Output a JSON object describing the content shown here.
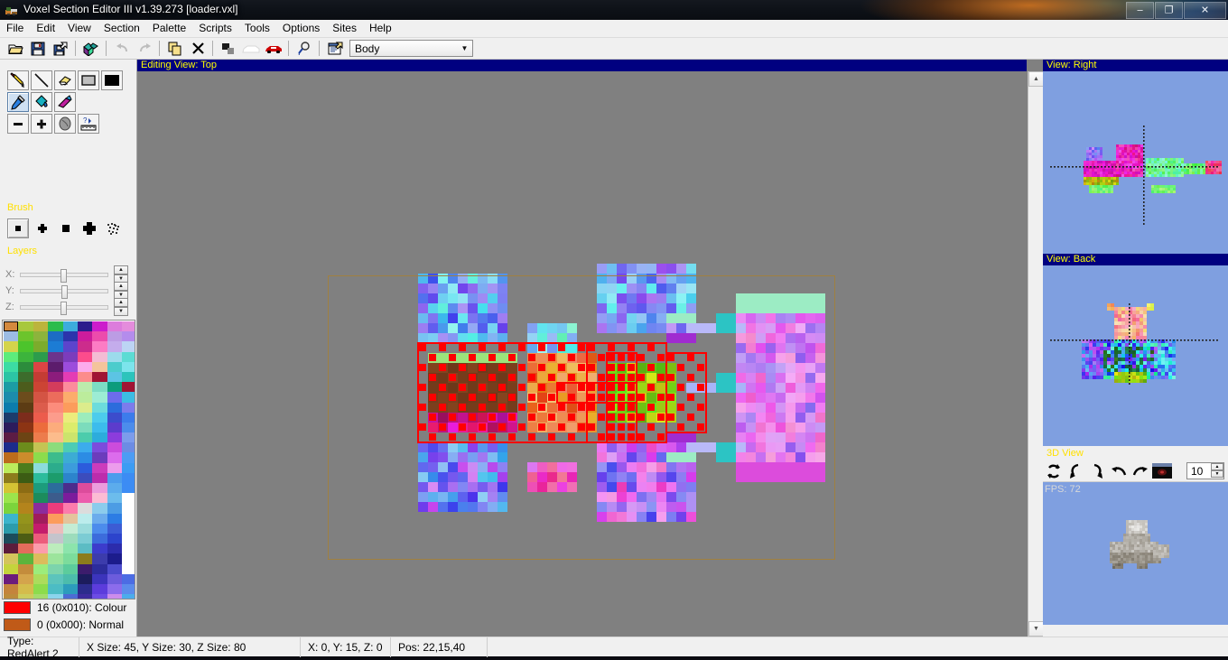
{
  "window": {
    "title": "Voxel Section Editor III v1.39.273 [loader.vxl]",
    "app_icon": "voxel-app-icon",
    "minimize_label": "–",
    "maximize_label": "❐",
    "close_label": "✕"
  },
  "menu": {
    "items": [
      {
        "label": "File"
      },
      {
        "label": "Edit"
      },
      {
        "label": "View"
      },
      {
        "label": "Section"
      },
      {
        "label": "Palette"
      },
      {
        "label": "Scripts"
      },
      {
        "label": "Tools"
      },
      {
        "label": "Options"
      },
      {
        "label": "Sites"
      },
      {
        "label": "Help"
      }
    ]
  },
  "toolbar": {
    "buttons": [
      {
        "name": "open-file-button",
        "icon": "folder-open-icon"
      },
      {
        "name": "save-file-button",
        "icon": "floppy-save-icon"
      },
      {
        "name": "save-as-button",
        "icon": "save-as-icon"
      },
      {
        "name": "new-section-button",
        "icon": "voxel-cube-icon"
      },
      {
        "name": "undo-button",
        "icon": "undo-arrow-icon"
      },
      {
        "name": "redo-button",
        "icon": "redo-arrow-icon"
      },
      {
        "name": "copy-button",
        "icon": "copy-pages-icon"
      },
      {
        "name": "delete-button",
        "icon": "x-delete-icon"
      },
      {
        "name": "normals-button",
        "icon": "two-squares-icon"
      },
      {
        "name": "white-vehicle-button",
        "icon": "white-car-icon"
      },
      {
        "name": "red-vehicle-button",
        "icon": "red-car-icon"
      },
      {
        "name": "zoom-button",
        "icon": "magnifier-icon"
      },
      {
        "name": "properties-button",
        "icon": "properties-window-icon"
      }
    ],
    "section_combo": {
      "value": "Body",
      "arrow_icon": "chevron-down-icon"
    }
  },
  "tools_panel": {
    "rows": [
      [
        {
          "name": "pencil-tool",
          "icon": "pencil-icon",
          "selected": false
        },
        {
          "name": "line-tool",
          "icon": "line-icon",
          "selected": false
        },
        {
          "name": "eraser-tool",
          "icon": "eraser-icon",
          "selected": false
        },
        {
          "name": "rectangle-tool",
          "icon": "rectangle-outline-icon",
          "selected": false
        },
        {
          "name": "filled-rectangle-tool",
          "icon": "rectangle-filled-icon",
          "selected": false
        }
      ],
      [
        {
          "name": "color-picker-tool",
          "icon": "eyedropper-icon",
          "selected": true
        },
        {
          "name": "fill-tool",
          "icon": "paint-bucket-icon",
          "selected": false
        },
        {
          "name": "smudge-tool",
          "icon": "smudge-icon",
          "selected": false
        }
      ],
      [
        {
          "name": "minus-tool",
          "icon": "minus-icon",
          "selected": false
        },
        {
          "name": "plus-tool",
          "icon": "plus-icon",
          "selected": false
        },
        {
          "name": "blob-tool",
          "icon": "blob-icon",
          "selected": false
        },
        {
          "name": "measure-tool",
          "icon": "ruler-question-icon",
          "selected": false
        }
      ]
    ],
    "brush": {
      "label": "Brush",
      "options": [
        {
          "name": "brush-dot",
          "icon": "small-square-icon",
          "selected": true
        },
        {
          "name": "brush-plus",
          "icon": "plus-brush-icon",
          "selected": false
        },
        {
          "name": "brush-square",
          "icon": "square-brush-icon",
          "selected": false
        },
        {
          "name": "brush-cross",
          "icon": "cross-brush-icon",
          "selected": false
        },
        {
          "name": "brush-noise",
          "icon": "noise-brush-icon",
          "selected": false
        }
      ]
    },
    "layers": {
      "label": "Layers",
      "sliders": [
        {
          "name": "layer-x-slider",
          "label": "X:",
          "pos_pct": 48
        },
        {
          "name": "layer-y-slider",
          "label": "Y:",
          "pos_pct": 49
        },
        {
          "name": "layer-z-slider",
          "label": "Z:",
          "pos_pct": 48
        }
      ]
    }
  },
  "palette": {
    "selected_index": 0,
    "info": [
      {
        "name": "primary-color",
        "swatch": "#ff0000",
        "text": "16 (0x010): Colour"
      },
      {
        "name": "secondary-color",
        "swatch": "#c05a18",
        "text": "0 (0x000): Normal"
      }
    ],
    "colors": [
      "#d4893e",
      "#a8c83c",
      "#bcb43c",
      "#2cbc4c",
      "#3cacdc",
      "#2c1c8c",
      "#cc1ccc",
      "#dc7cdc",
      "#9cbce4",
      "#6cc42c",
      "#8cb43c",
      "#1c6cc4",
      "#2c34ac",
      "#cc1c9c",
      "#ec4cac",
      "#bc9ce4",
      "#d4d44c",
      "#4cc42c",
      "#7cac2c",
      "#1c7cd4",
      "#5c44cc",
      "#cc2c8c",
      "#fc7cc4",
      "#c4acec",
      "#5cec7c",
      "#3cb43c",
      "#2c9c4c",
      "#6c348c",
      "#7c3cbc",
      "#fc4c8c",
      "#f4bcd4",
      "#9cdcec",
      "#3cdca4",
      "#2c8c3c",
      "#dc4444",
      "#5c1c6c",
      "#9c4cdc",
      "#fcacec",
      "#f4c49c",
      "#4ccccc",
      "#2cc4a4",
      "#3c6c2c",
      "#c43c34",
      "#8c1c7c",
      "#e43cb4",
      "#fc8c8c",
      "#a01434",
      "#5cc4e4",
      "#1c9ca4",
      "#4c5c1c",
      "#cc4434",
      "#d43c5c",
      "#fc8c9c",
      "#bcecac",
      "#7cdcc4",
      "#0c9c7c",
      "#1c8cac",
      "#6c4c1c",
      "#d45444",
      "#ec6c5c",
      "#fcac6c",
      "#bcec9c",
      "#9cecd4",
      "#6c6cec",
      "#0c7cac",
      "#5c3c14",
      "#dc5c4c",
      "#fc8c7c",
      "#fc9c5c",
      "#dcec8c",
      "#6cdcdc",
      "#2c6cdc",
      "#1c3c6c",
      "#7c2c1c",
      "#ec5c4c",
      "#fc9c8c",
      "#ecec7c",
      "#9cecbc",
      "#4cccec",
      "#3c4ccc",
      "#2c1c5c",
      "#8c3414",
      "#ec6c3c",
      "#fcac7c",
      "#dcec6c",
      "#7cdcbc",
      "#3cbcec",
      "#5c3ccc",
      "#5c1c44",
      "#6c4414",
      "#ec7c4c",
      "#fcbc8c",
      "#cce46c",
      "#4cccac",
      "#2cacdc",
      "#8c3cdc",
      "#1c2c8c",
      "#6c8c1c",
      "#c4c454",
      "#8cdc7c",
      "#4cccb4",
      "#3cacec",
      "#7c4cdc",
      "#cc4cdc",
      "#bc6c1c",
      "#cc8c2c",
      "#8cdc4c",
      "#3cbc8c",
      "#3cacd4",
      "#2c8ce4",
      "#6c3cbc",
      "#dc6cec",
      "#bcec5c",
      "#4c7c1c",
      "#8cdcdc",
      "#2cac8c",
      "#3c9cdc",
      "#2c5cdc",
      "#cc3cbc",
      "#ec9cec",
      "#8c7c1c",
      "#3c5c14",
      "#2cbc9c",
      "#1c9c6c",
      "#2c84cc",
      "#3c4cbc",
      "#bc2cac",
      "#4c9cec",
      "#d4c434",
      "#8c6c14",
      "#1c9c7c",
      "#2c6c9c",
      "#4c2c8c",
      "#dc4c9c",
      "#ec9cdc",
      "#5cacec",
      "#9ce44c",
      "#a47c1c",
      "#1c8c5c",
      "#3c5c8c",
      "#7c1c9c",
      "#ec5cac",
      "#fcbcd4",
      "#6cbcec",
      "#7cd43c",
      "#b4841c",
      "#8c2c9c",
      "#ec3c7c",
      "#fc7cac",
      "#dcdcdc",
      "#8cccec",
      "#4c9ce4",
      "#3cb4cc",
      "#94941c",
      "#a01c5c",
      "#fc9c5c",
      "#e4c49c",
      "#bcecec",
      "#6cacec",
      "#2c7ce4",
      "#2c9cac",
      "#8c8c1c",
      "#c41c6c",
      "#ecbcbc",
      "#c4ecd4",
      "#9cdcdc",
      "#4c8cec",
      "#3c5cd4",
      "#1c4c5c",
      "#4c5c14",
      "#ec5c7c",
      "#c4c4cc",
      "#9cdcbc",
      "#7cccd4",
      "#3c6cdc",
      "#2c44cc",
      "#5c1c3c",
      "#e46c5c",
      "#fc9cac",
      "#bcecbc",
      "#8ce4ac",
      "#5cbcc4",
      "#3c3ccc",
      "#2c2cac",
      "#d4c45c",
      "#5cb43c",
      "#dcbc5c",
      "#9ce49c",
      "#7cdc9c",
      "#8c7c1c",
      "#3c3cac",
      "#1c1c8c",
      "#c4d43c",
      "#c48c3c",
      "#9cec7c",
      "#7cd4ac",
      "#5ccc9c",
      "#3c1c6c",
      "#2c2c9c",
      "#4c4ccc",
      "#6c1c7c",
      "#d4a44c",
      "#acdc5c",
      "#5cc4bc",
      "#4cbcac",
      "#1c1c5c",
      "#3c34bc",
      "#6c5cdc",
      "#c4843c",
      "#d4bc4c",
      "#8cdc4c",
      "#4cbcc4",
      "#2c9cbc",
      "#2c2c8c",
      "#5c3cdc",
      "#8c6cec",
      "#bc8c3c",
      "#cccc5c",
      "#a4dc6c",
      "#8cd4ec",
      "#4c6cd4",
      "#3c2c9c",
      "#6c4ce4",
      "#cc8cec"
    ]
  },
  "editing_view": {
    "header": "Editing View:  Top",
    "scroll_up_icon": "scroll-up-arrow",
    "scroll_down_icon": "scroll-down-arrow"
  },
  "side_views": [
    {
      "name": "view-right",
      "header": "View:  Right"
    },
    {
      "name": "view-back",
      "header": "View:  Back"
    }
  ],
  "view3d": {
    "label": "3D View",
    "fps": "FPS: 72",
    "buttons": [
      {
        "name": "rotate-reset-button",
        "icon": "rotate-refresh-icon"
      },
      {
        "name": "rotate-left-button",
        "icon": "rotate-left-icon"
      },
      {
        "name": "rotate-right-button",
        "icon": "rotate-right-icon"
      },
      {
        "name": "turn-left-button",
        "icon": "arrow-turn-left-icon"
      },
      {
        "name": "turn-right-button",
        "icon": "arrow-turn-right-icon"
      },
      {
        "name": "render-preview-button",
        "icon": "render-thumbnail-icon"
      }
    ],
    "zoom_value": "10",
    "spin_up_icon": "spin-up-arrow",
    "spin_down_icon": "spin-down-arrow"
  },
  "status_bar": {
    "cells": [
      {
        "name": "status-type",
        "text": "Type: RedAlert 2"
      },
      {
        "name": "status-size",
        "text": "X Size: 45, Y Size: 30, Z Size: 80"
      },
      {
        "name": "status-coords",
        "text": "X: 0, Y: 15, Z: 0"
      },
      {
        "name": "status-pos",
        "text": "Pos: 22,15,40"
      },
      {
        "name": "status-extra",
        "text": ""
      }
    ]
  },
  "colors": {
    "titlebar_caption": "#000080",
    "caption_text": "#ffff00",
    "canvas_bg": "#808080",
    "view_bg": "#7f9fe0",
    "section_label": "#ffe000",
    "selection_red": "#ff0000",
    "selection_box_border": "#a08040"
  }
}
